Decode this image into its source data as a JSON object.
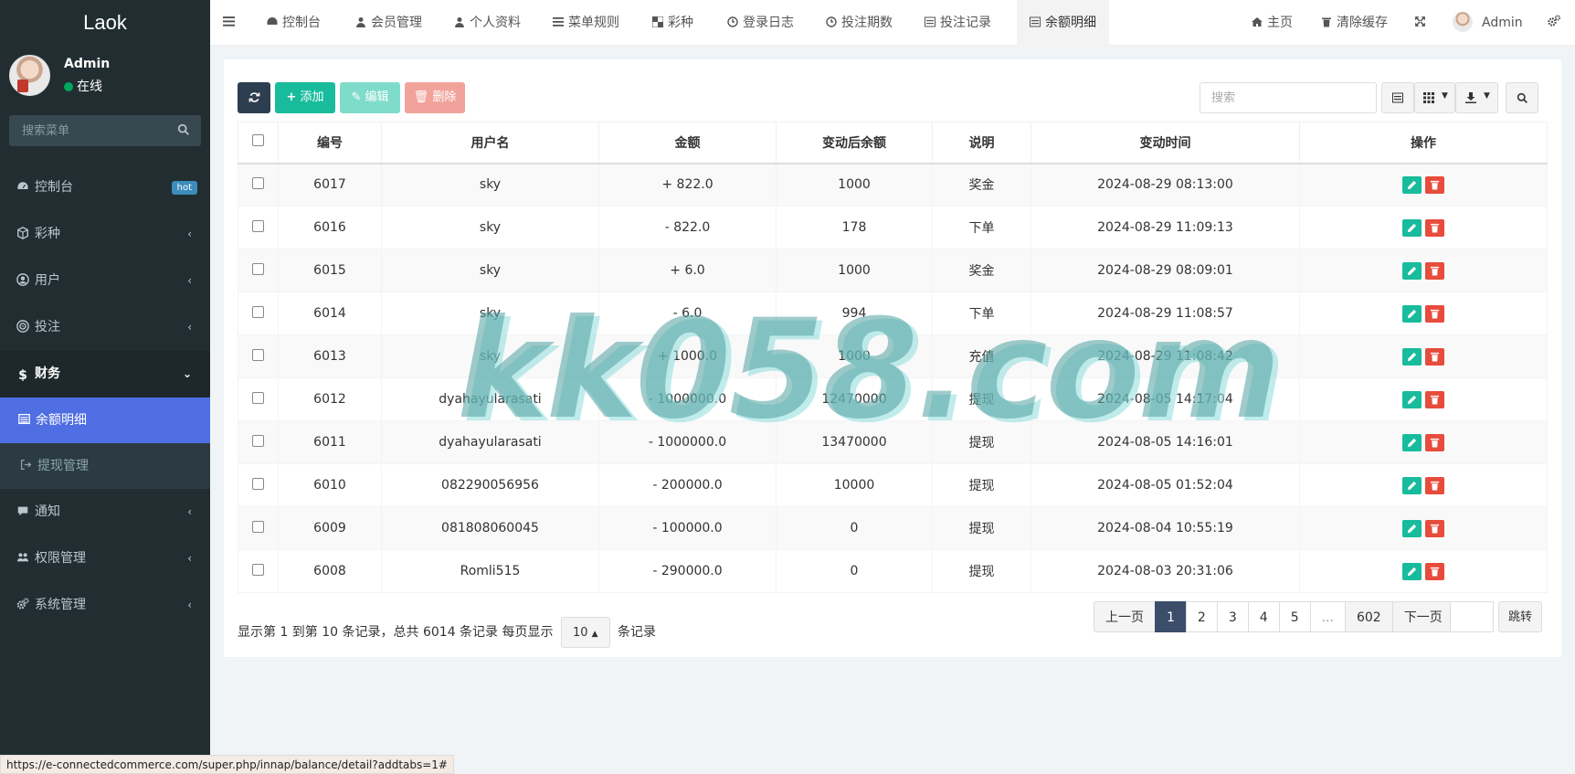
{
  "app": {
    "logo": "Laok"
  },
  "user": {
    "name": "Admin",
    "status": "在线"
  },
  "sidebar": {
    "search_placeholder": "搜索菜单",
    "items": [
      {
        "label": "控制台",
        "badge": "hot"
      },
      {
        "label": "彩种"
      },
      {
        "label": "用户"
      },
      {
        "label": "投注"
      },
      {
        "label": "财务"
      },
      {
        "label": "通知"
      },
      {
        "label": "权限管理"
      },
      {
        "label": "系统管理"
      }
    ],
    "sub_items": [
      {
        "label": "余额明细"
      },
      {
        "label": "提现管理"
      }
    ]
  },
  "topbar": {
    "tabs": [
      "控制台",
      "会员管理",
      "个人资料",
      "菜单规则",
      "彩种",
      "登录日志",
      "投注期数",
      "投注记录",
      "余额明细"
    ],
    "home": "主页",
    "clear_cache": "清除缓存",
    "admin": "Admin"
  },
  "toolbar": {
    "add": "添加",
    "edit": "编辑",
    "delete": "删除",
    "search_placeholder": "搜索"
  },
  "table": {
    "headers": [
      "编号",
      "用户名",
      "金额",
      "变动后余额",
      "说明",
      "变动时间",
      "操作"
    ],
    "rows": [
      {
        "id": "6017",
        "user": "sky",
        "amount": "+ 822.0",
        "balance": "1000",
        "note": "奖金",
        "time": "2024-08-29 08:13:00"
      },
      {
        "id": "6016",
        "user": "sky",
        "amount": "- 822.0",
        "balance": "178",
        "note": "下单",
        "time": "2024-08-29 11:09:13"
      },
      {
        "id": "6015",
        "user": "sky",
        "amount": "+ 6.0",
        "balance": "1000",
        "note": "奖金",
        "time": "2024-08-29 08:09:01"
      },
      {
        "id": "6014",
        "user": "sky",
        "amount": "- 6.0",
        "balance": "994",
        "note": "下单",
        "time": "2024-08-29 11:08:57"
      },
      {
        "id": "6013",
        "user": "sky",
        "amount": "+ 1000.0",
        "balance": "1000",
        "note": "充值",
        "time": "2024-08-29 11:08:42"
      },
      {
        "id": "6012",
        "user": "dyahayularasati",
        "amount": "- 1000000.0",
        "balance": "12470000",
        "note": "提现",
        "time": "2024-08-05 14:17:04"
      },
      {
        "id": "6011",
        "user": "dyahayularasati",
        "amount": "- 1000000.0",
        "balance": "13470000",
        "note": "提现",
        "time": "2024-08-05 14:16:01"
      },
      {
        "id": "6010",
        "user": "082290056956",
        "amount": "- 200000.0",
        "balance": "10000",
        "note": "提现",
        "time": "2024-08-05 01:52:04"
      },
      {
        "id": "6009",
        "user": "081808060045",
        "amount": "- 100000.0",
        "balance": "0",
        "note": "提现",
        "time": "2024-08-04 10:55:19"
      },
      {
        "id": "6008",
        "user": "Romli515",
        "amount": "- 290000.0",
        "balance": "0",
        "note": "提现",
        "time": "2024-08-03 20:31:06"
      }
    ]
  },
  "footer": {
    "info_prefix": "显示第 1 到第 10 条记录，总共 6014 条记录 每页显示",
    "page_size": "10",
    "info_suffix": "条记录",
    "prev": "上一页",
    "pages": [
      "1",
      "2",
      "3",
      "4",
      "5",
      "...",
      "602"
    ],
    "next": "下一页",
    "jump": "跳转"
  },
  "watermark": "kk058.com",
  "statusbar": "https://e-connectedcommerce.com/super.php/innap/balance/detail?addtabs=1#"
}
